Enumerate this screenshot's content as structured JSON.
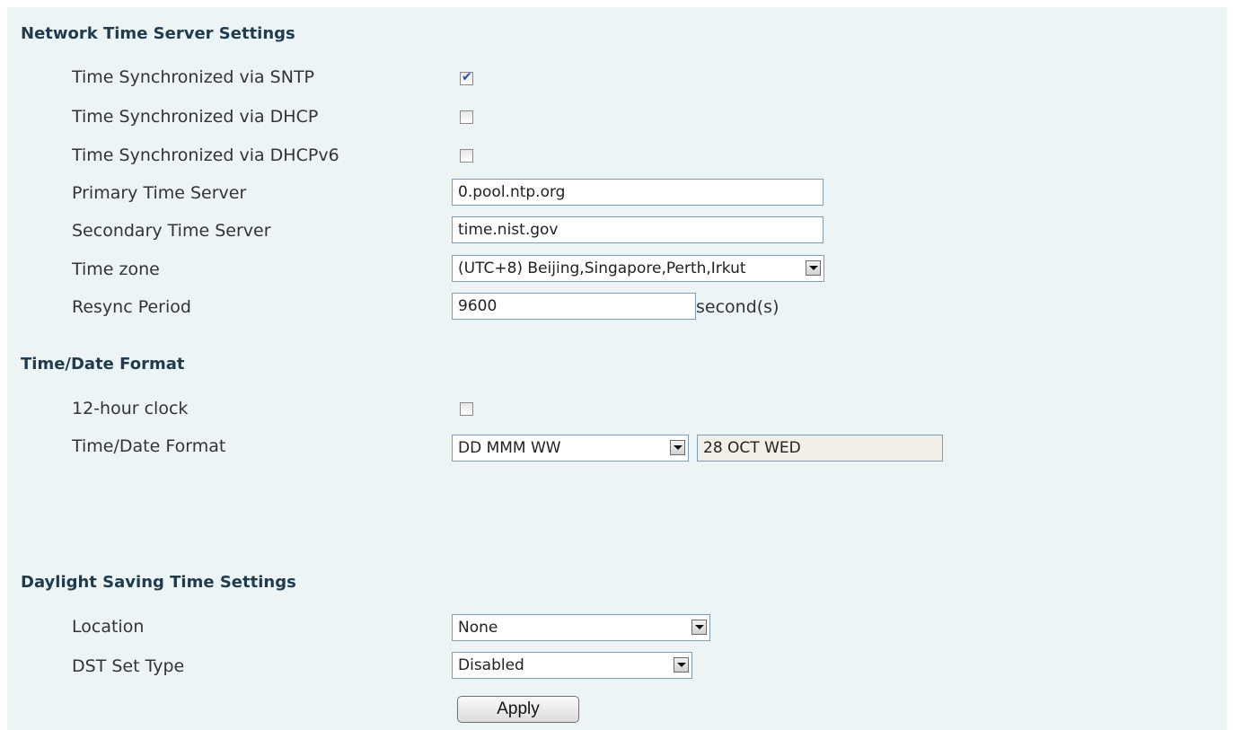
{
  "network": {
    "title": "Network Time Server Settings",
    "sntp_label": "Time Synchronized via SNTP",
    "sntp_checked": true,
    "dhcp_label": "Time Synchronized via DHCP",
    "dhcp_checked": false,
    "dhcpv6_label": "Time Synchronized via DHCPv6",
    "dhcpv6_checked": false,
    "primary_label": "Primary Time Server",
    "primary_value": "0.pool.ntp.org",
    "secondary_label": "Secondary Time Server",
    "secondary_value": "time.nist.gov",
    "timezone_label": "Time zone",
    "timezone_value": "(UTC+8) Beijing,Singapore,Perth,Irkut",
    "resync_label": "Resync Period",
    "resync_value": "9600",
    "resync_unit": "second(s)"
  },
  "format": {
    "title": "Time/Date Format",
    "clock12_label": "12-hour clock",
    "clock12_checked": false,
    "date_format_label": "Time/Date Format",
    "date_format_value": "DD MMM WW",
    "date_preview": "28 OCT WED"
  },
  "dst": {
    "title": "Daylight Saving Time Settings",
    "location_label": "Location",
    "location_value": "None",
    "type_label": "DST Set Type",
    "type_value": "Disabled"
  },
  "actions": {
    "apply_label": "Apply"
  },
  "icons": {
    "checkmark": "checkmark-icon",
    "dropdown": "chevron-down-icon"
  }
}
